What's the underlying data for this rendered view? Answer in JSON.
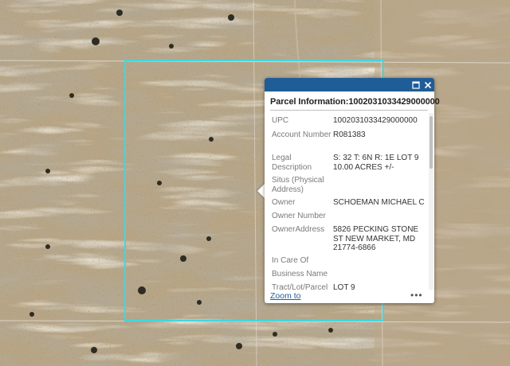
{
  "map": {
    "parcel_outline_color": "#3fd8e0",
    "terrain_color": "#b7a586"
  },
  "popup": {
    "title": "Parcel Information:1002031033429000000",
    "header_color": "#1f5d98",
    "maximize_icon": "maximize-icon",
    "close_icon": "close-icon",
    "fields": [
      {
        "label": "UPC",
        "value": "1002031033429000000"
      },
      {
        "label": "Account Number",
        "value": "R081383"
      },
      {
        "label": "Legal Description",
        "value": "S: 32 T: 6N R: 1E LOT 9 10.00 ACRES +/-"
      },
      {
        "label": "Situs (Physical Address)",
        "value": ""
      },
      {
        "label": "Owner",
        "value": "SCHOEMAN MICHAEL C"
      },
      {
        "label": "Owner Number",
        "value": ""
      },
      {
        "label": "OwnerAddress",
        "value": "5826 PECKING STONE ST NEW MARKET, MD 21774-6866"
      },
      {
        "label": "In Care Of",
        "value": ""
      },
      {
        "label": "Business Name",
        "value": ""
      },
      {
        "label": "Tract/Lot/Parcel",
        "value": "LOT 9"
      }
    ],
    "zoom_label": "Zoom to",
    "more_label": "•••"
  }
}
